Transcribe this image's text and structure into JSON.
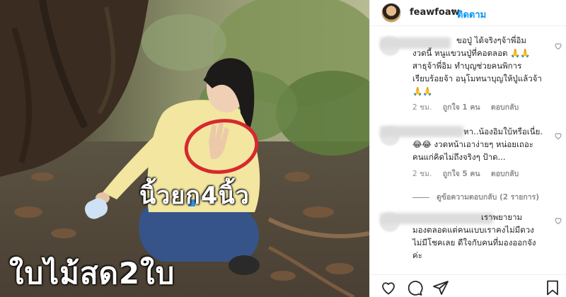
{
  "photo": {
    "caption_finger": "นิ้วยก4นิ้ว",
    "caption_leaves": "ใบไม้สด2ใบ"
  },
  "header": {
    "username": "feawfoaw",
    "separator": "•",
    "follow_label": "ติดตาม"
  },
  "comments": [
    {
      "lines": [
        "ขอปู่ ได้จริงๆจ้าพี่อิม",
        "งวดนี้ หนูแขวนปู่ที่คอตลอด 🙏🙏",
        "สาธุจ้าพี่อิม ทำบุญช่วยคนพิการ",
        "เรียบร้อยจ้า อนุโมทนาบุญให้ปู่แล้วจ้า",
        "🙏🙏"
      ],
      "time": "2 ชม.",
      "likes": "ถูกใจ 1 คน",
      "reply": "ตอบกลับ"
    },
    {
      "lines": [
        "หา..น้องอิมใบ้หรือเนี่ย.",
        "😂😂 งวดหน้าเอาง่ายๆ หน่อยเถอะ",
        "คนแก่คิดไม่ถึงจริงๆ ป้าด..."
      ],
      "time": "2 ชม.",
      "likes": "ถูกใจ 5 คน",
      "reply": "ตอบกลับ",
      "view_replies": "ดูข้อความตอบกลับ (2 รายการ)"
    },
    {
      "lines": [
        "เราพยายาม",
        "มองตลอดแต่คนแบบเราคงไม่มีดวง",
        "ไม่มีโชคเลย ดีใจกับคนที่มองออกจัง",
        "ค่ะ"
      ]
    }
  ],
  "icons": {
    "like": "heart-icon",
    "comment": "comment-icon",
    "share": "share-icon",
    "save": "bookmark-icon"
  },
  "colors": {
    "follow": "#0095f6",
    "text": "#262626",
    "muted": "#8e8e8e",
    "circle": "#d8282e",
    "shirt": "#f2e6a0"
  }
}
